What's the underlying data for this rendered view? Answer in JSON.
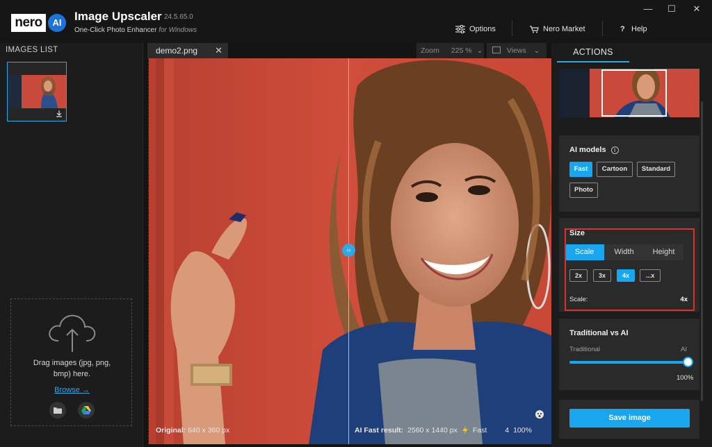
{
  "app": {
    "logo_text": "nero",
    "logo_ai": "AI",
    "title": "Image Upscaler",
    "version": "24.5.65.0",
    "subtitle": "One-Click Photo Enhancer",
    "subtitle_platform": "for Windows"
  },
  "header": {
    "options_label": "Options",
    "market_label": "Nero Market",
    "help_label": "Help",
    "help_icon_glyph": "?"
  },
  "window_controls": {
    "minimize": "—",
    "maximize": "☐",
    "close": "✕"
  },
  "left": {
    "title": "IMAGES LIST",
    "drop_text": "Drag images (jpg, png, bmp) here.",
    "browse": "Browse →"
  },
  "center": {
    "tab_name": "demo2.png",
    "tab_close": "✕",
    "zoom_label": "Zoom",
    "zoom_value": "225 %",
    "views_label": "Views",
    "original_label": "Original:",
    "original_size": "640 x 360 px",
    "ai_label": "AI Fast result:",
    "ai_size": "2560 x 1440 px",
    "ai_mode": "Fast",
    "ai_scale": "4",
    "ai_percent": "100%",
    "divider_glyph": "‹›"
  },
  "right": {
    "actions_tab": "ACTIONS",
    "ai_models_title": "AI models",
    "models": [
      "Fast",
      "Cartoon",
      "Standard",
      "Photo"
    ],
    "active_model": "Fast",
    "size_title": "Size",
    "size_modes": [
      "Scale",
      "Width",
      "Height"
    ],
    "active_size_mode": "Scale",
    "scales": [
      "2x",
      "3x",
      "4x",
      "...x"
    ],
    "active_scale": "4x",
    "scale_label": "Scale:",
    "scale_value": "4x",
    "trad_title": "Traditional vs AI",
    "trad_left": "Traditional",
    "trad_right": "AI",
    "trad_value": "100%",
    "trad_level": 1.0,
    "save_label": "Save image"
  },
  "colors": {
    "accent": "#18a6ee",
    "highlight": "#e0302c",
    "wall": "#c94a3a"
  },
  "icons": [
    "options-sliders-icon",
    "market-cart-icon",
    "help-icon",
    "download-icon",
    "cloud-upload-icon",
    "folder-icon",
    "google-drive-icon",
    "info-icon",
    "face-icon",
    "lightning-icon",
    "views-icon"
  ]
}
